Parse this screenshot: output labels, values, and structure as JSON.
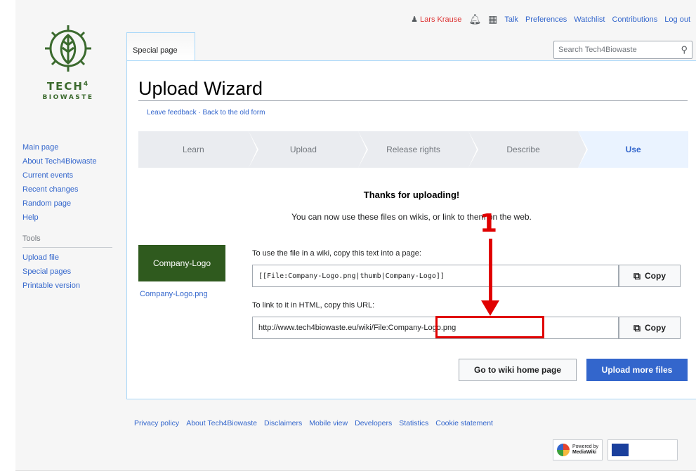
{
  "site": {
    "logo_main": "TECH",
    "logo_sup": "4",
    "logo_sub": "BIOWASTE"
  },
  "sidebar": {
    "navigation": [
      "Main page",
      "About Tech4Biowaste",
      "Current events",
      "Recent changes",
      "Random page",
      "Help"
    ],
    "tools_heading": "Tools",
    "tools": [
      "Upload file",
      "Special pages",
      "Printable version"
    ]
  },
  "personal": {
    "user": "Lars Krause",
    "links": [
      "Talk",
      "Preferences",
      "Watchlist",
      "Contributions",
      "Log out"
    ]
  },
  "tabs": {
    "special": "Special page"
  },
  "search": {
    "placeholder": "Search Tech4Biowaste"
  },
  "page": {
    "title": "Upload Wizard",
    "leave_feedback": "Leave feedback",
    "separator": " · ",
    "old_form": "Back to the old form"
  },
  "steps": [
    {
      "label": "Learn",
      "active": false
    },
    {
      "label": "Upload",
      "active": false
    },
    {
      "label": "Release rights",
      "active": false
    },
    {
      "label": "Describe",
      "active": false
    },
    {
      "label": "Use",
      "active": true
    }
  ],
  "use": {
    "thanks": "Thanks for uploading!",
    "subtitle": "You can now use these files on wikis, or link to them on the web.",
    "thumb_text": "Company-Logo",
    "thumb_caption": "Company-Logo.png",
    "wiki_label": "To use the file in a wiki, copy this text into a page:",
    "wiki_text": "[[File:Company-Logo.png|thumb|Company-Logo]]",
    "html_label": "To link to it in HTML, copy this URL:",
    "html_url": "http://www.tech4biowaste.eu/wiki/File:Company-Logo.png",
    "copy_label": "Copy",
    "home_button": "Go to wiki home page",
    "more_button": "Upload more files"
  },
  "annotation": {
    "number": "1",
    "color": "#e00000"
  },
  "footer": {
    "links": [
      "Privacy policy",
      "About Tech4Biowaste",
      "Disclaimers",
      "Mobile view",
      "Developers",
      "Statistics",
      "Cookie statement"
    ],
    "powered_by": "Powered by",
    "mediawiki": "MediaWiki"
  },
  "colors": {
    "link": "#3366cc",
    "brand_green": "#3b6a2e",
    "thumb_bg": "#2f5a1e",
    "progressive": "#3366cc"
  }
}
